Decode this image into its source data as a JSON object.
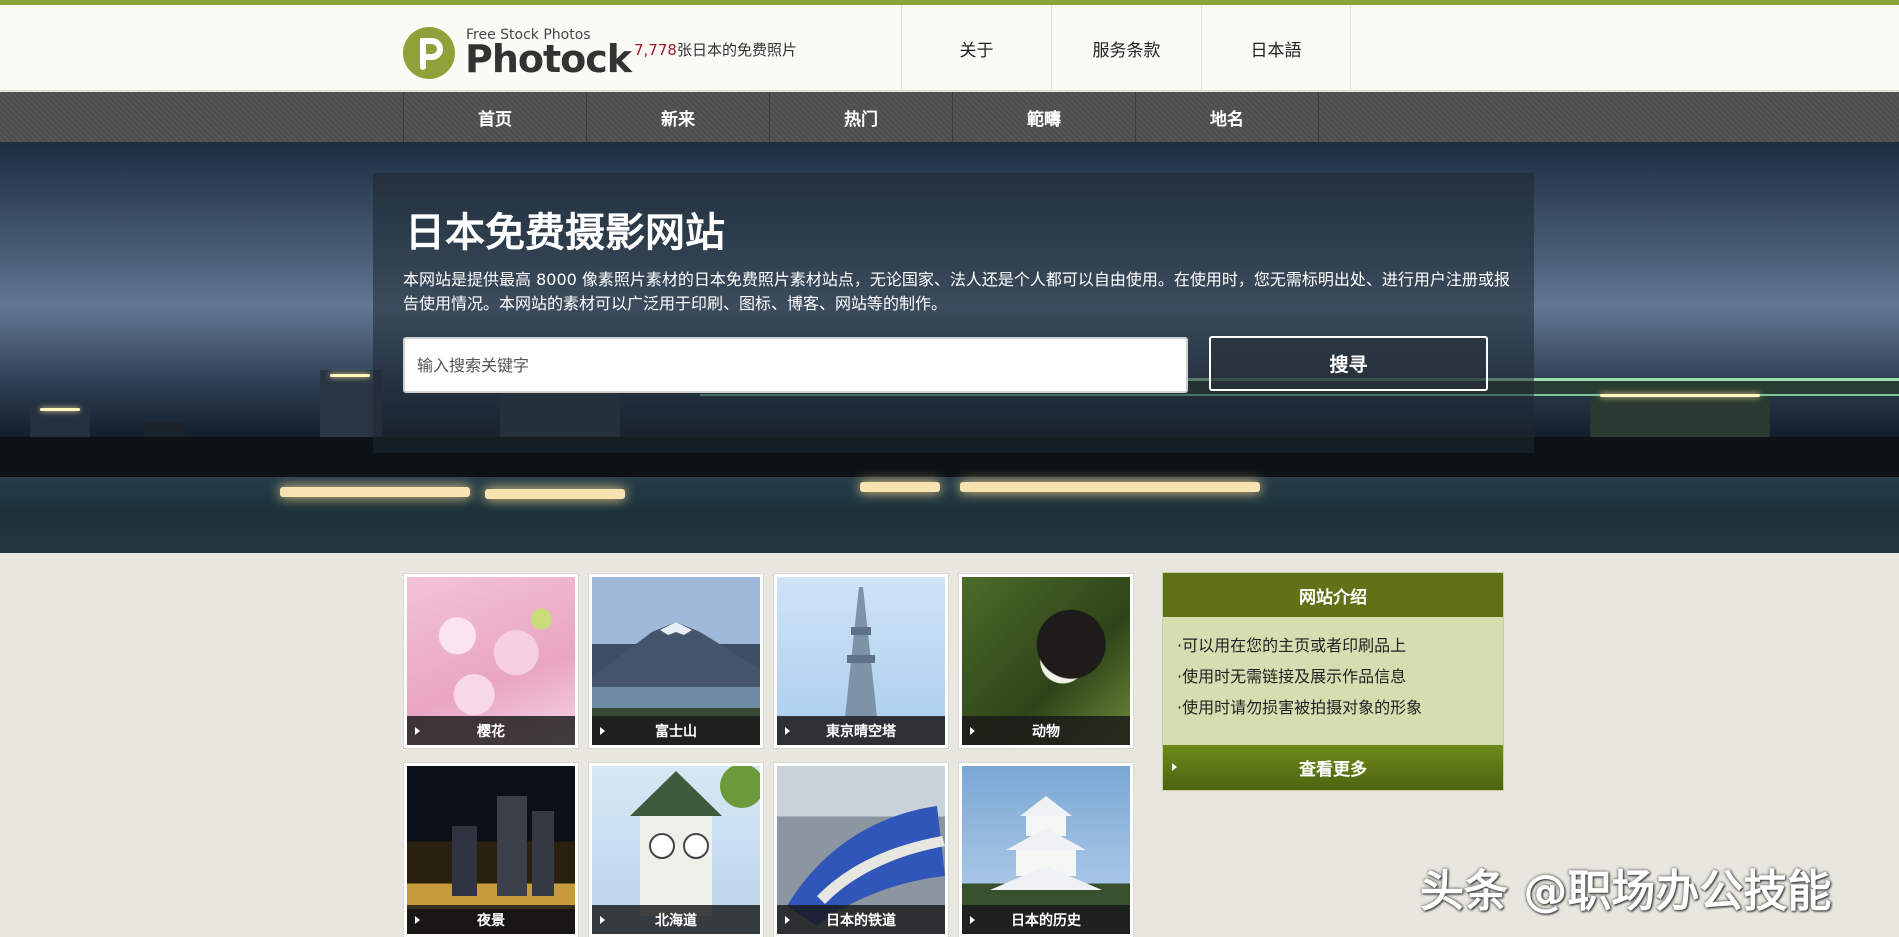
{
  "brand": {
    "tagline": "Free Stock Photos",
    "name": "Photock",
    "count_number": "7,778",
    "count_suffix": "张日本的免费照片",
    "colors": {
      "accent": "#8ea23a",
      "count": "#a0182c",
      "sidebar_head": "#5f7316"
    }
  },
  "header_nav": [
    {
      "label": "关于"
    },
    {
      "label": "服务条款"
    },
    {
      "label": "日本語"
    }
  ],
  "main_nav": [
    {
      "label": "首页"
    },
    {
      "label": "新来"
    },
    {
      "label": "热门"
    },
    {
      "label": "範疇"
    },
    {
      "label": "地名"
    }
  ],
  "hero": {
    "title": "日本免费摄影网站",
    "description": "本网站是提供最高 8000 像素照片素材的日本免费照片素材站点，无论国家、法人还是个人都可以自由使用。在使用时，您无需标明出处、进行用户注册或报告使用情况。本网站的素材可以广泛用于印刷、图标、博客、网站等的制作。"
  },
  "search": {
    "placeholder": "输入搜索关键字",
    "button_label": "搜寻"
  },
  "categories": [
    {
      "label": "樱花",
      "icon": "cherry-blossom-photo"
    },
    {
      "label": "富士山",
      "icon": "mount-fuji-photo"
    },
    {
      "label": "東京晴空塔",
      "icon": "tokyo-skytree-photo"
    },
    {
      "label": "动物",
      "icon": "cat-photo"
    },
    {
      "label": "夜景",
      "icon": "night-view-photo"
    },
    {
      "label": "北海道",
      "icon": "clock-tower-photo"
    },
    {
      "label": "日本的铁道",
      "icon": "train-photo"
    },
    {
      "label": "日本的历史",
      "icon": "castle-photo"
    }
  ],
  "sidebar": {
    "title": "网站介绍",
    "items": [
      "·可以用在您的主页或者印刷品上",
      "·使用时无需链接及展示作品信息",
      "·使用时请勿损害被拍摄对象的形象"
    ],
    "more_label": "查看更多"
  },
  "watermark": "头条 @职场办公技能"
}
